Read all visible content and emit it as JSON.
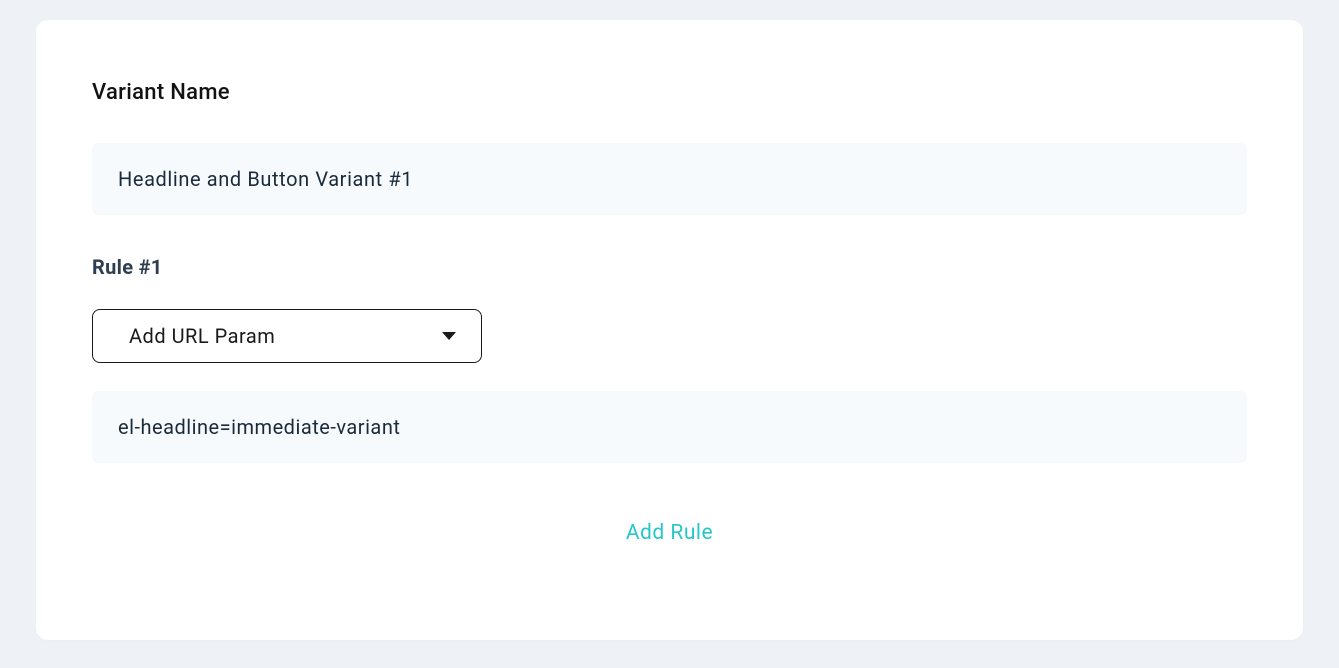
{
  "variantName": {
    "label": "Variant Name",
    "value": "Headline and Button Variant #1"
  },
  "rule": {
    "label": "Rule #1",
    "typeSelected": "Add URL Param",
    "value": "el-headline=immediate-variant"
  },
  "actions": {
    "addRule": "Add Rule"
  }
}
